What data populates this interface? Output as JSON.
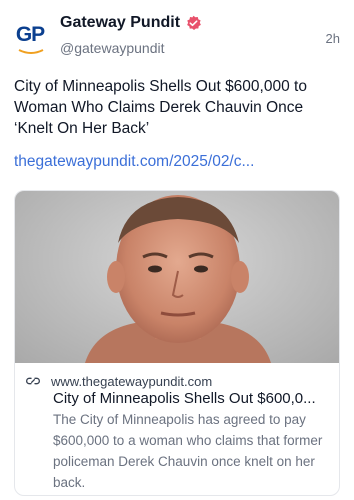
{
  "author": {
    "display_name": "Gateway Pundit",
    "handle": "@gatewaypundit",
    "avatar_text": "GP",
    "verified": true
  },
  "timestamp": "2h",
  "post": {
    "text": "City of Minneapolis Shells Out $600,000 to Woman Who Claims Derek Chauvin Once ‘Knelt On Her Back’",
    "link_text": "thegatewaypundit.com/2025/02/c..."
  },
  "link_card": {
    "image_icon": "mugshot-photo",
    "domain": "www.thegatewaypundit.com",
    "title": "City of Minneapolis Shells Out $600,0...",
    "description": "The City of Minneapolis has agreed to pay $600,000 to a woman who claims that former policeman Derek Chauvin once knelt on her back."
  },
  "colors": {
    "link": "#3b6fd8",
    "logo_blue": "#0b3f8f",
    "logo_orange": "#f0a020",
    "verified_badge": "#e8516b",
    "muted_text": "#6b7280"
  }
}
